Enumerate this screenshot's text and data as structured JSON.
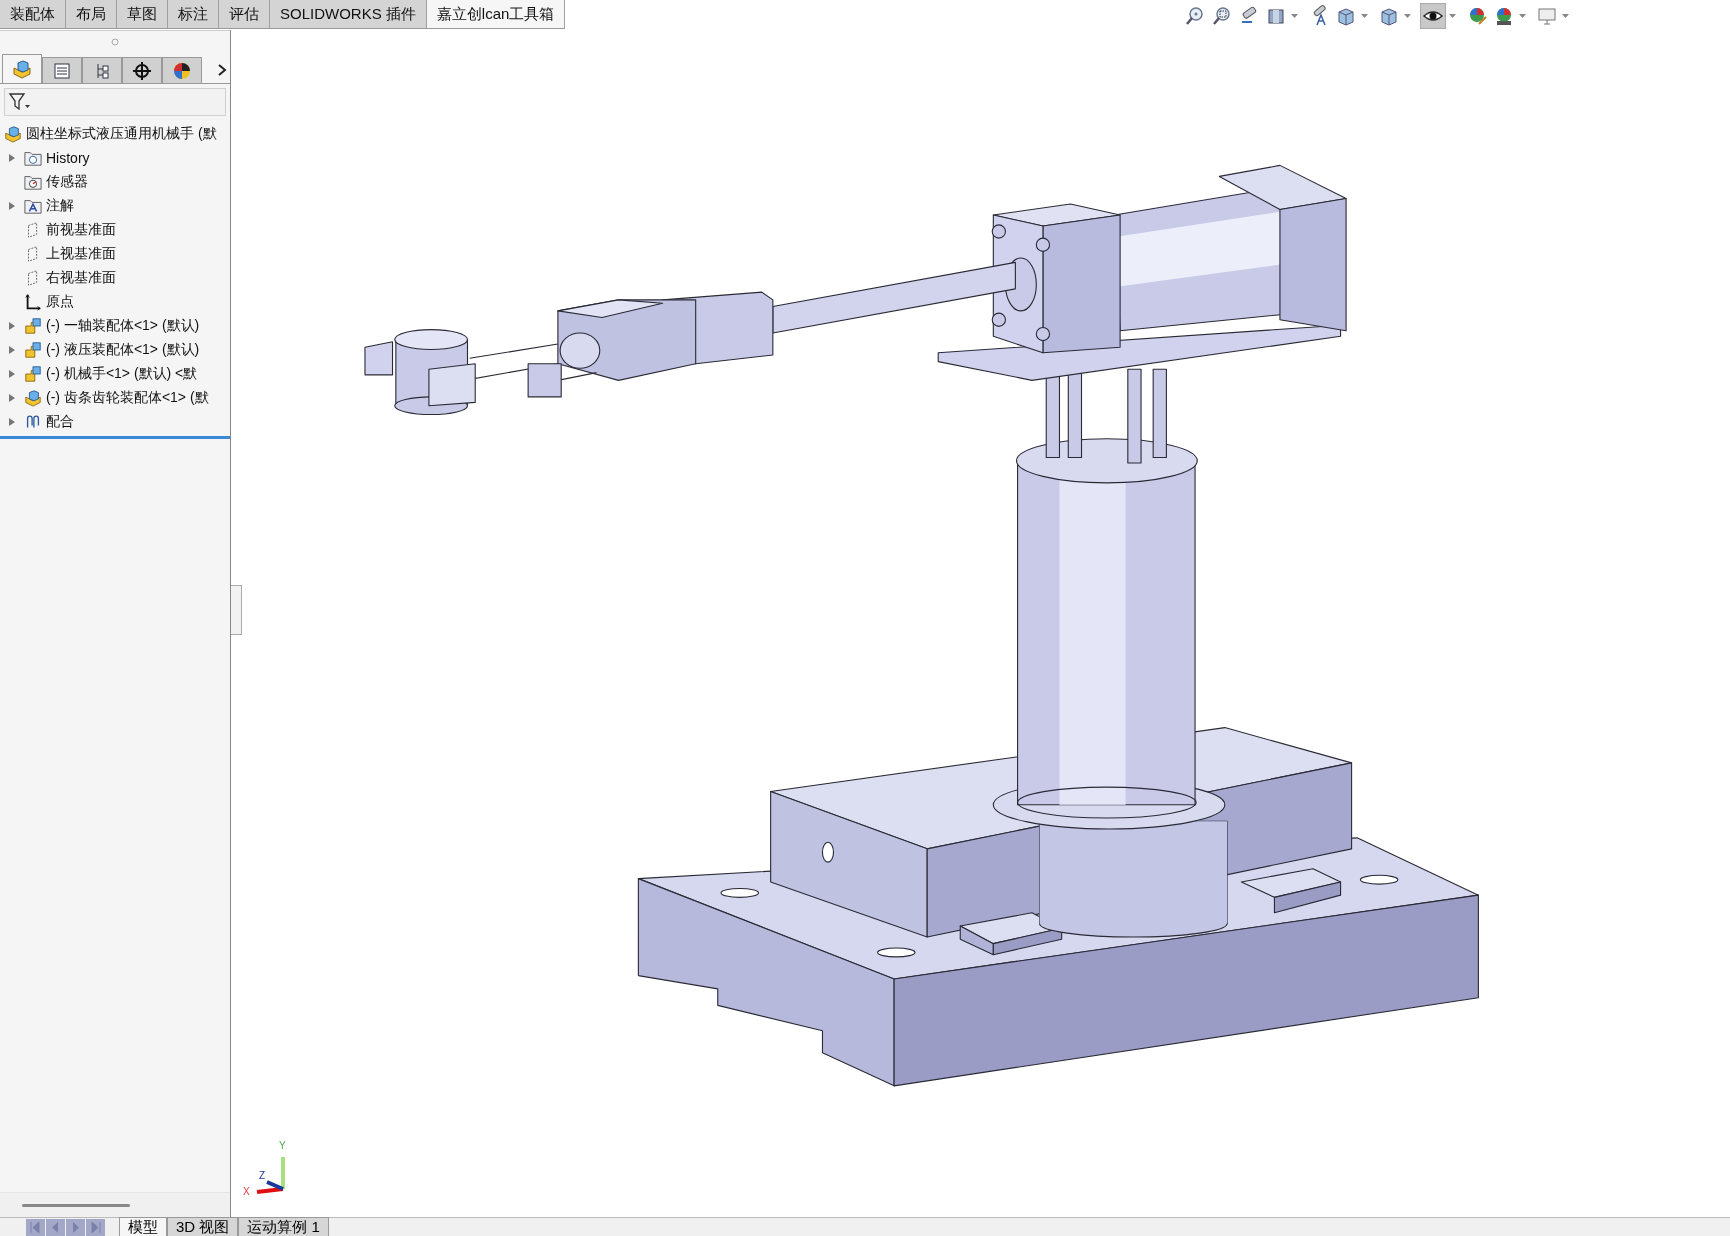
{
  "ribbon_tabs": [
    {
      "label": "装配体",
      "selected": false
    },
    {
      "label": "布局",
      "selected": false
    },
    {
      "label": "草图",
      "selected": false
    },
    {
      "label": "标注",
      "selected": false
    },
    {
      "label": "评估",
      "selected": false
    },
    {
      "label": "SOLIDWORKS 插件",
      "selected": false
    },
    {
      "label": "嘉立创lcan工具箱",
      "selected": true
    }
  ],
  "view_toolbar": [
    {
      "kind": "zoom-fit",
      "pressed": false
    },
    {
      "kind": "zoom-area",
      "pressed": false
    },
    {
      "kind": "previous-view",
      "pressed": false
    },
    {
      "kind": "section-view",
      "pressed": false
    },
    {
      "kind": "annotation-view",
      "pressed": false
    },
    {
      "kind": "view-orientation",
      "pressed": false
    },
    {
      "kind": "display-style",
      "pressed": false
    },
    {
      "kind": "hide-show",
      "pressed": true
    },
    {
      "kind": "edit-appearance",
      "pressed": false
    },
    {
      "kind": "apply-scene",
      "pressed": false
    },
    {
      "kind": "view-settings",
      "pressed": false
    }
  ],
  "panel_tabs": [
    {
      "kind": "feature-tree",
      "selected": true
    },
    {
      "kind": "property",
      "selected": false
    },
    {
      "kind": "configuration",
      "selected": false
    },
    {
      "kind": "dimxpert",
      "selected": false
    },
    {
      "kind": "display",
      "selected": false
    }
  ],
  "feature_tree": {
    "root": {
      "label": "圆柱坐标式液压通用机械手 (默"
    },
    "items": [
      {
        "kind": "history",
        "label": "History",
        "expandable": true
      },
      {
        "kind": "sensor",
        "label": "传感器",
        "expandable": false
      },
      {
        "kind": "annotation",
        "label": "注解",
        "expandable": true
      },
      {
        "kind": "plane",
        "label": "前视基准面",
        "expandable": false
      },
      {
        "kind": "plane",
        "label": "上视基准面",
        "expandable": false
      },
      {
        "kind": "plane",
        "label": "右视基准面",
        "expandable": false
      },
      {
        "kind": "origin",
        "label": "原点",
        "expandable": false
      },
      {
        "kind": "subassembly",
        "label": "(-) 一轴装配体<1> (默认)",
        "expandable": true
      },
      {
        "kind": "subassembly",
        "label": "(-) 液压装配体<1> (默认)",
        "expandable": true
      },
      {
        "kind": "subassembly",
        "label": "(-) 机械手<1> (默认) <默",
        "expandable": true
      },
      {
        "kind": "assembly",
        "label": "(-) 齿条齿轮装配体<1> (默",
        "expandable": true
      },
      {
        "kind": "mates",
        "label": "配合",
        "expandable": true
      }
    ]
  },
  "triad": {
    "x": "X",
    "y": "Y",
    "z": "Z"
  },
  "bottom_tabs": [
    {
      "label": "模型",
      "selected": true
    },
    {
      "label": "3D 视图",
      "selected": false
    },
    {
      "label": "运动算例 1",
      "selected": false
    }
  ]
}
